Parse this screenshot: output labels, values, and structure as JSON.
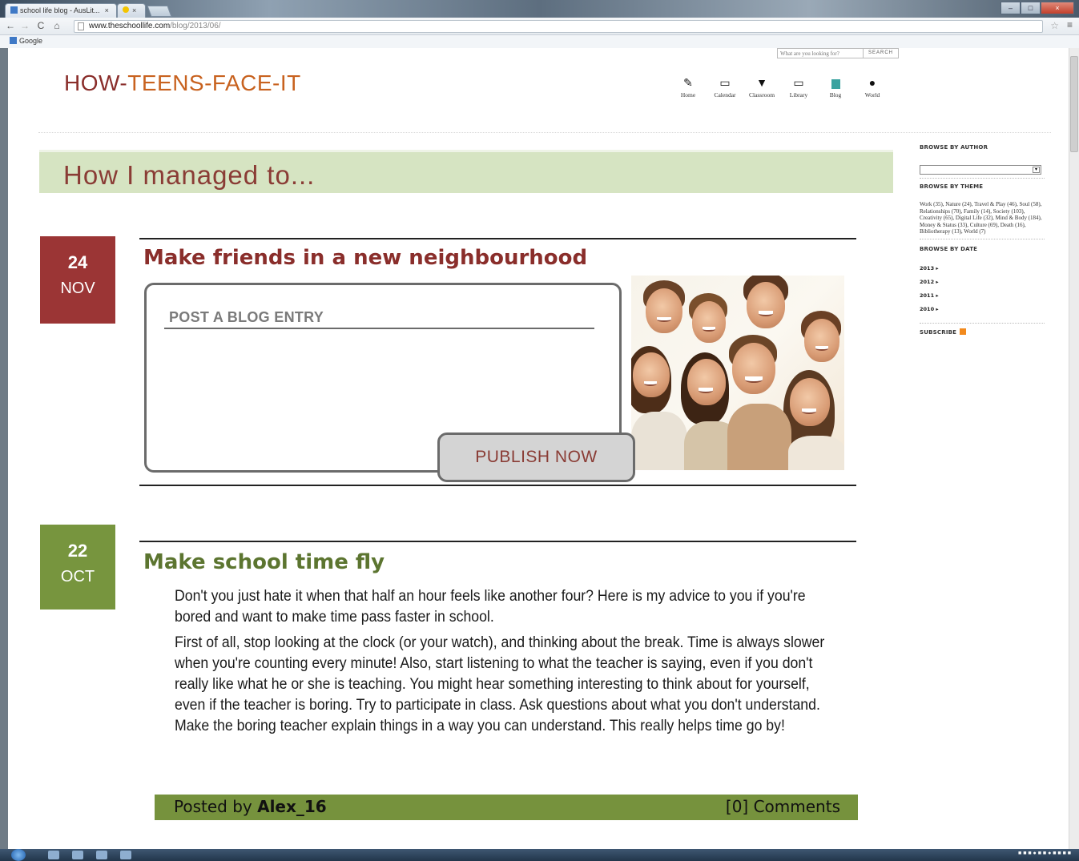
{
  "browser": {
    "tab1_title": "school life blog - AusLit...",
    "tab2_title": "",
    "url_host": "www.theschoollife.com",
    "url_path": "/blog/2013/06/",
    "bookmark": "Google"
  },
  "header": {
    "title_part1": "HOW-",
    "title_part2": "TEENS-FACE-IT",
    "search_placeholder": "What are you looking for?",
    "search_button": "SEARCH"
  },
  "nav": [
    {
      "label": "Home",
      "icon": "paper-plane-icon"
    },
    {
      "label": "Calendar",
      "icon": "calendar-icon"
    },
    {
      "label": "Classroom",
      "icon": "classroom-icon"
    },
    {
      "label": "Library",
      "icon": "book-icon"
    },
    {
      "label": "Blog",
      "icon": "blog-icon"
    },
    {
      "label": "World",
      "icon": "globe-icon"
    }
  ],
  "banner": {
    "title": "How I managed to..."
  },
  "post1": {
    "day": "24",
    "month": "NOV",
    "title": "Make friends in a new neighbourhood",
    "blog_box_label": "POST A BLOG ENTRY",
    "publish_label": "PUBLISH NOW"
  },
  "post2": {
    "day": "22",
    "month": "OCT",
    "title": "Make school time fly",
    "paragraph1": "Don't you just hate it when that half an hour feels like another four? Here is my advice to you if you're bored and want to make time pass faster in school.",
    "paragraph2": "First of all, stop looking at the clock (or your watch), and thinking about the break. Time is always slower when you're counting every minute! Also, start listening to what the teacher is saying, even if you don't really like what he or she is teaching. You might hear something interesting to think about for yourself, even if the teacher is boring. Try to participate in class. Ask questions about what you don't understand. Make the boring teacher explain things in a way you can understand. This really helps time go by!",
    "posted_by": "Posted by ",
    "author": "Alex_16",
    "comments": "[0] Comments"
  },
  "sidebar": {
    "browse_author": "BROWSE BY AUTHOR",
    "browse_theme": "BROWSE BY THEME",
    "themes": "Work (35), Nature (24), Travel & Play (46), Soul (58), Relationships (70), Family (14), Society (103), Creativity (65), Digital Life (32), Mind & Body (184), Money & Status (33), Culture (69), Death (16), Bibliotherapy (13), World (7)",
    "browse_date": "BROWSE BY DATE",
    "years": [
      "2013 ▸",
      "2012 ▸",
      "2011 ▸",
      "2010 ▸"
    ],
    "subscribe": "SUBSCRIBE"
  },
  "colors": {
    "accent_red": "#9b3535",
    "accent_green": "#77953e",
    "banner_bg": "#d6e4c2"
  }
}
